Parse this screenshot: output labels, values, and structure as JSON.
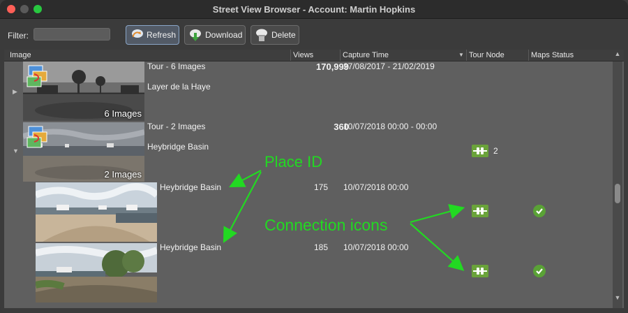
{
  "window": {
    "title": "Street View Browser - Account: Martin Hopkins"
  },
  "toolbar": {
    "filter_label": "Filter:",
    "filter_value": "",
    "refresh_label": "Refresh",
    "download_label": "Download",
    "delete_label": "Delete"
  },
  "table": {
    "headers": {
      "image": "Image",
      "views": "Views",
      "capture": "Capture Time",
      "tour_node": "Tour Node",
      "maps_status": "Maps Status"
    },
    "rows": [
      {
        "title": "Tour - 6 Images",
        "place": "Layer de la Haye",
        "views": "170,999",
        "capture": "27/08/2017 - 21/02/2019",
        "thumb_label": "6 Images"
      },
      {
        "title": "Tour - 2 Images",
        "place": "Heybridge Basin",
        "views": "360",
        "capture": "10/07/2018 00:00 - 00:00",
        "thumb_label": "2 Images",
        "node_count": "2"
      },
      {
        "place": "Heybridge Basin",
        "views": "175",
        "capture": "10/07/2018 00:00"
      },
      {
        "place": "Heybridge Basin",
        "views": "185",
        "capture": "10/07/2018 00:00"
      }
    ]
  },
  "annotations": {
    "place_id": "Place ID",
    "connection_icons": "Connection icons"
  },
  "colors": {
    "annotation": "#22d922",
    "node_icon": "#6aa33a",
    "check": "#5aa236"
  },
  "icons": [
    "refresh-icon",
    "download-icon",
    "delete-icon",
    "tour-badge-icon",
    "connection-icon",
    "check-icon",
    "expander-icon"
  ]
}
